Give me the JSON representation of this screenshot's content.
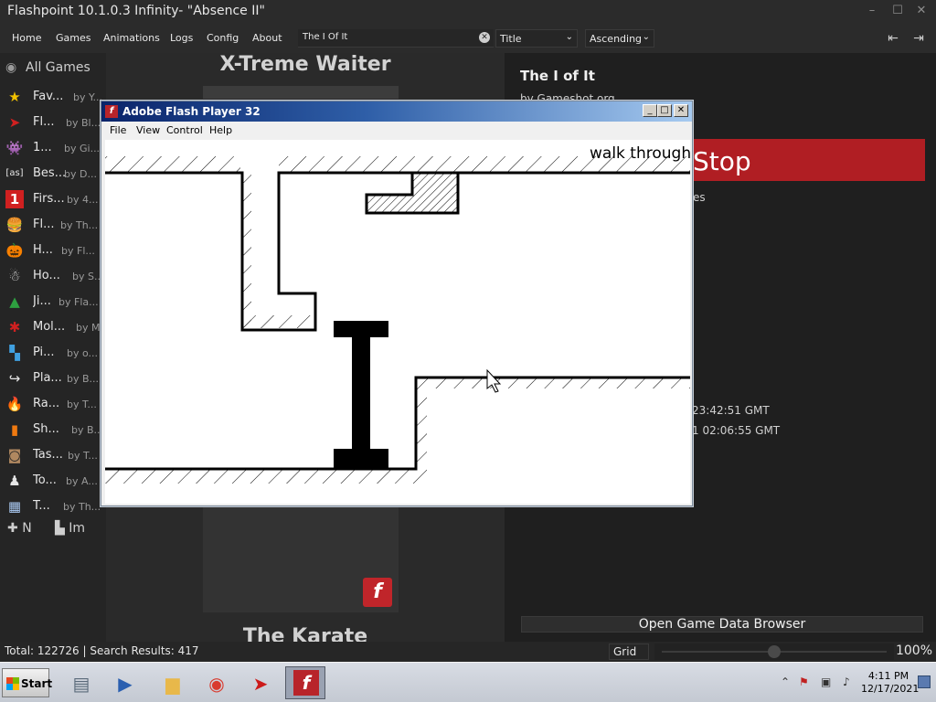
{
  "window": {
    "title": "Flashpoint 10.1.0.3 Infinity- \"Absence II\"",
    "controls": [
      "–",
      "☐",
      "✕"
    ]
  },
  "nav": {
    "items": [
      "Home",
      "Games",
      "Animations",
      "Logs",
      "Config",
      "About"
    ],
    "search_value": "The I Of It",
    "search_clear_icon": "clear-icon",
    "order_by": "Title",
    "order_dir": "Ascending",
    "right_icons": [
      "collapse-left-icon",
      "collapse-right-icon"
    ]
  },
  "sidebar": {
    "all_label": "All Games",
    "items": [
      {
        "name": "Fav...",
        "by": "by Y...",
        "icon": "star-icon",
        "color": "#f2c200"
      },
      {
        "name": "Fl...",
        "by": "by Bl...",
        "icon": "play-arrow-icon",
        "color": "#d02020"
      },
      {
        "name": "1...",
        "by": "by Gi...",
        "icon": "space-invader-icon",
        "color": "#ffffff"
      },
      {
        "name": "Bes...",
        "by": "by D...",
        "icon": "as-icon",
        "color": "#e6e6e6"
      },
      {
        "name": "Firs...",
        "by": "by 4...",
        "icon": "number-one-icon",
        "color": "#d02020"
      },
      {
        "name": "Fl...",
        "by": "by Th...",
        "icon": "burger-icon",
        "color": "#e0a030"
      },
      {
        "name": "H...",
        "by": "by Fl...",
        "icon": "pumpkin-icon",
        "color": "#f07a10"
      },
      {
        "name": "Ho...",
        "by": "by S...",
        "icon": "santa-icon",
        "color": "#e6e6e6"
      },
      {
        "name": "Ji...",
        "by": "by Fla...",
        "icon": "tree-icon",
        "color": "#2ea040"
      },
      {
        "name": "Mol...",
        "by": "by M...",
        "icon": "burst-icon",
        "color": "#d02020"
      },
      {
        "name": "Pi...",
        "by": "by o...",
        "icon": "pixel-icon",
        "color": "#40a0e0"
      },
      {
        "name": "Pla...",
        "by": "by B...",
        "icon": "share-icon",
        "color": "#e6e6e6"
      },
      {
        "name": "Ra...",
        "by": "by T...",
        "icon": "flame-icon",
        "color": "#f06010"
      },
      {
        "name": "Sh...",
        "by": "by B...",
        "icon": "waveform-icon",
        "color": "#f07a10"
      },
      {
        "name": "Tas...",
        "by": "by T...",
        "icon": "portrait-icon",
        "color": "#b08860"
      },
      {
        "name": "To...",
        "by": "by A...",
        "icon": "silhouette-icon",
        "color": "#e6e6e6"
      },
      {
        "name": "T...",
        "by": "by Th...",
        "icon": "blocks-icon",
        "color": "#a8c8f0"
      }
    ],
    "footer_new": "N",
    "footer_import": "Im"
  },
  "center": {
    "game_title_top": "X-Treme Waiter",
    "game_title_bottom": "The Karate",
    "platform_badge": "flash-icon"
  },
  "details": {
    "title": "The I of It",
    "developer": "by Gameshot.org",
    "stop_label": "Stop",
    "frag_es": "es",
    "date_added": "23:42:51 GMT",
    "date_modified": "1 02:06:55 GMT",
    "open_data_browser": "Open Game Data Browser"
  },
  "status": {
    "total": "Total: 122726",
    "separator": "|",
    "results": "Search Results: 417",
    "layout": "Grid",
    "zoom": "100%",
    "zoom_fraction": 0.5
  },
  "taskbar": {
    "start_label": "Start",
    "apps": [
      "server-icon",
      "powershell-icon",
      "folder-icon",
      "chrome-icon",
      "flashpoint-icon",
      "flash-player-icon"
    ],
    "time": "4:11 PM",
    "date": "12/17/2021"
  },
  "flash_player": {
    "title": "Adobe Flash Player 32",
    "menu": [
      "File",
      "View",
      "Control",
      "Help"
    ],
    "stage_text": "walk through"
  },
  "colors": {
    "accent_stop": "#b01e23",
    "flash_red": "#c0252a"
  }
}
